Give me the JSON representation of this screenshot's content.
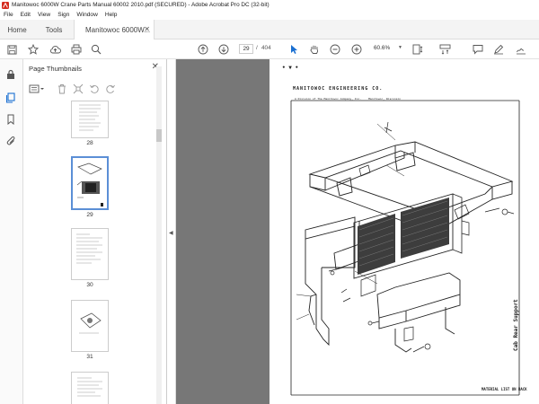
{
  "window": {
    "title": "Manitowoc 6000W Crane Parts Manual 60002 2010.pdf (SECURED) - Adobe Acrobat Pro DC (32-bit)"
  },
  "menu": [
    "File",
    "Edit",
    "View",
    "Sign",
    "Window",
    "Help"
  ],
  "tabs": {
    "home": "Home",
    "tools": "Tools",
    "document": "Manitowoc 6000W..."
  },
  "toolbar": {
    "current_page": "29",
    "separator": "/",
    "total_pages": "404",
    "zoom": "60.6%"
  },
  "thumbnail_panel": {
    "title": "Page Thumbnails",
    "thumbnails": [
      {
        "label": "28"
      },
      {
        "label": "29",
        "selected": true
      },
      {
        "label": "30"
      },
      {
        "label": "31"
      },
      {
        "label": ""
      }
    ]
  },
  "document_page": {
    "corner_mark": "• ▼ •",
    "header": "MANITOWOC ENGINEERING CO.",
    "subheader_left": "A Division of The Manitowoc Company, Inc.",
    "subheader_right": "Manitowoc, Wisconsin",
    "side_title": "Cab Rear Support",
    "footer": "MATERIAL LIST ON BACK"
  },
  "colors": {
    "accent": "#5b8fd6",
    "viewer_bg": "#777777",
    "acrobat_red": "#d52b1e",
    "select_blue": "#1a6fd1"
  }
}
